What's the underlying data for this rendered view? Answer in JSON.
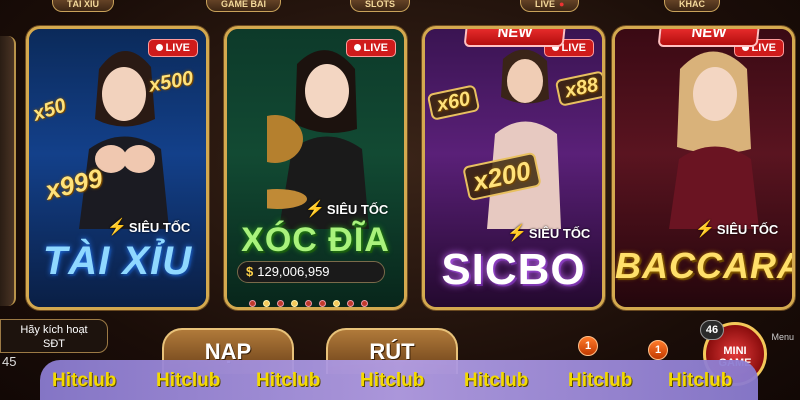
{
  "topnav": {
    "tabs": [
      {
        "label": "TÀI XỈU"
      },
      {
        "label": "GAME BÀI"
      },
      {
        "label": "SLOTS"
      },
      {
        "label": "LIVE"
      },
      {
        "label": "KHÁC"
      }
    ]
  },
  "cards": [
    {
      "live_label": "LIVE",
      "speed_label": "SIÊU TỐC",
      "title": "TÀI XỈU",
      "multipliers": [
        "x50",
        "x500",
        "x999"
      ]
    },
    {
      "live_label": "LIVE",
      "speed_label": "SIÊU TỐC",
      "title": "XÓC ĐĨA",
      "jackpot_currency": "$",
      "jackpot_value": "129,006,959"
    },
    {
      "new_label": "NEW",
      "live_label": "LIVE",
      "speed_label": "SIÊU TỐC",
      "title": "SICBO",
      "multipliers": [
        "x60",
        "x88",
        "x200"
      ]
    },
    {
      "new_label": "NEW",
      "live_label": "LIVE",
      "speed_label": "SIÊU TỐC",
      "title": "BACCARAT"
    }
  ],
  "bottom": {
    "activate_line1": "Hãy kích hoạt",
    "activate_line2": "SĐT",
    "left_count": "45",
    "deposit_label": "NẠP",
    "withdraw_label": "RÚT",
    "badge_a": "1",
    "badge_b": "1",
    "mini_game_label": "MINI GAME",
    "mini_game_count": "46",
    "menu_label": "Menu"
  },
  "watermark": [
    "Hitclub",
    "Hitclub",
    "Hitclub",
    "Hitclub",
    "Hitclub",
    "Hitclub",
    "Hitclub"
  ],
  "colors": {
    "frame_gold": "#d4a94f",
    "live_red": "#cf1b1b",
    "watermark_text": "#ffe500",
    "watermark_bg": "#b39ee6"
  }
}
